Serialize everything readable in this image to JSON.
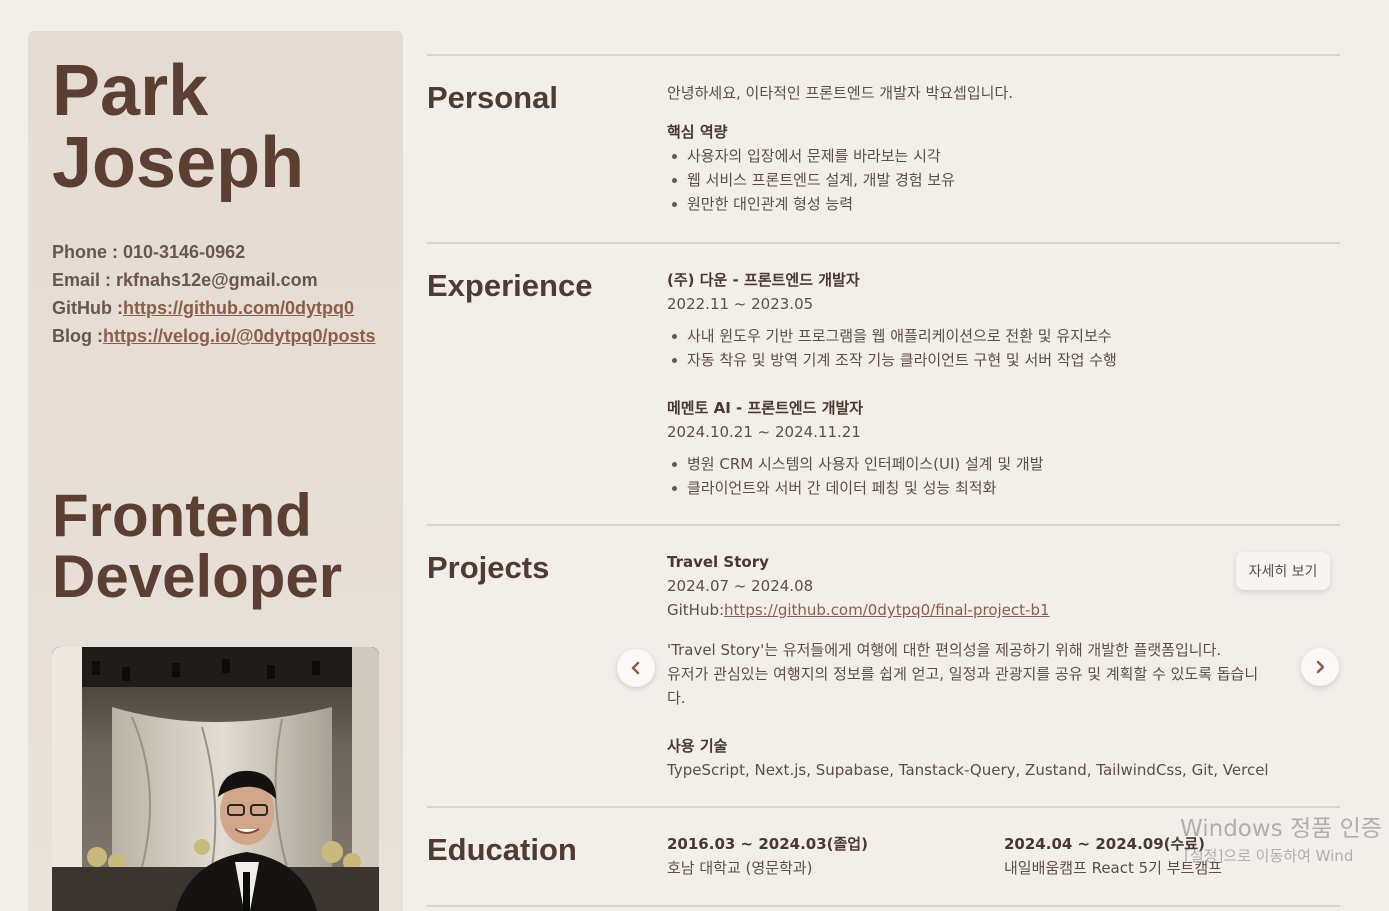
{
  "sidebar": {
    "name_line1": "Park",
    "name_line2": "Joseph",
    "contact": {
      "phone_label": "Phone : ",
      "phone": "010-3146-0962",
      "email_label": "Email : ",
      "email": "rkfnahs12e@gmail.com",
      "github_label": "GitHub :",
      "github_url": "https://github.com/0dytpq0",
      "blog_label": "Blog :",
      "blog_url": "https://velog.io/@0dytpq0/posts"
    },
    "role_line1": "Frontend",
    "role_line2": "Developer"
  },
  "personal": {
    "title": "Personal",
    "intro": "안녕하세요, 이타적인 프론트엔드 개발자 박요셉입니다.",
    "core_heading": "핵심 역량",
    "core_items": [
      "사용자의 입장에서 문제를 바라보는 시각",
      "웹 서비스 프론트엔드 설계, 개발 경험 보유",
      "원만한 대인관계 형성 능력"
    ]
  },
  "experience": {
    "title": "Experience",
    "jobs": [
      {
        "heading": "(주) 다운 - 프론트엔드 개발자",
        "period": "2022.11 ~ 2023.05",
        "items": [
          "사내 윈도우 기반 프로그램을 웹 애플리케이션으로 전환 및 유지보수",
          "자동 착유 및 방역 기계 조작 기능 클라이언트 구현 및 서버 작업 수행"
        ]
      },
      {
        "heading": "메멘토 AI - 프론트엔드 개발자",
        "period": "2024.10.21 ~ 2024.11.21",
        "items": [
          "병원 CRM 시스템의 사용자 인터페이스(UI) 설계 및 개발",
          "클라이언트와 서버 간 데이터 페칭 및 성능 최적화"
        ]
      }
    ]
  },
  "projects": {
    "title": "Projects",
    "name": "Travel Story",
    "period": "2024.07 ~ 2024.08",
    "github_label": "GitHub:",
    "github_url": "https://github.com/0dytpq0/final-project-b1",
    "desc_line1": "'Travel Story'는 유저들에게 여행에 대한 편의성을 제공하기 위해 개발한 플랫폼입니다.",
    "desc_line2": "유저가 관심있는 여행지의 정보를 쉽게 얻고, 일정과 관광지를 공유 및 계획할 수 있도록 돕습니",
    "desc_line3": "다.",
    "tech_heading": "사용 기술",
    "tech": "TypeScript, Next.js, Supabase, Tanstack-Query, Zustand, TailwindCss, Git, Vercel",
    "detail_button": "자세히 보기",
    "prev_icon": "chevron-left-icon",
    "next_icon": "chevron-right-icon"
  },
  "education": {
    "title": "Education",
    "items": [
      {
        "period": "2016.03 ~ 2024.03(졸업)",
        "school": "호남 대학교 (영문학과)"
      },
      {
        "period": "2024.04 ~ 2024.09(수료)",
        "school": "내일배움캠프 React 5기 부트캠프"
      }
    ]
  },
  "watermark": {
    "line1": "Windows 정품 인증",
    "line2": "[설정]으로 이동하여 Wind"
  },
  "colors": {
    "background": "#f2efeb",
    "sidebar": "#e6ddd4",
    "heading": "#5b3f33",
    "link": "#8c5d4b"
  }
}
